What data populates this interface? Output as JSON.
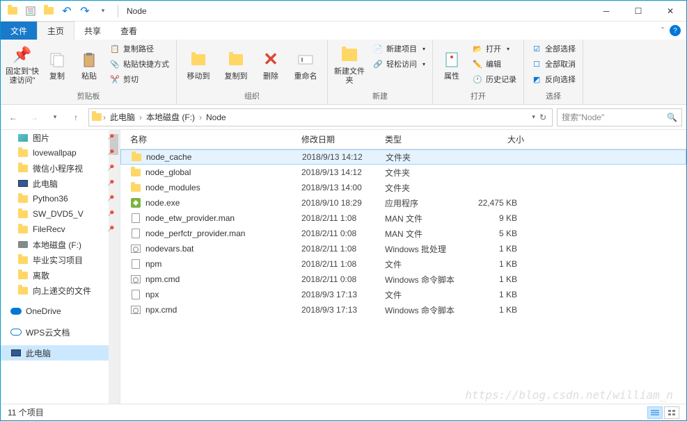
{
  "titlebar": {
    "title": "Node"
  },
  "tabs": {
    "file": "文件",
    "home": "主页",
    "share": "共享",
    "view": "查看"
  },
  "ribbon": {
    "pin": "固定到\"快速访问\"",
    "copy": "复制",
    "paste": "粘贴",
    "copypath": "复制路径",
    "pasteshortcut": "粘贴快捷方式",
    "cut": "剪切",
    "clipboard_group": "剪贴板",
    "moveto": "移动到",
    "copyto": "复制到",
    "delete": "删除",
    "rename": "重命名",
    "organize_group": "组织",
    "newfolder": "新建文件夹",
    "newitem": "新建项目",
    "easyaccess": "轻松访问",
    "new_group": "新建",
    "properties": "属性",
    "open": "打开",
    "edit": "编辑",
    "history": "历史记录",
    "open_group": "打开",
    "selectall": "全部选择",
    "selectnone": "全部取消",
    "invertsel": "反向选择",
    "select_group": "选择"
  },
  "breadcrumb": {
    "pc": "此电脑",
    "drive": "本地磁盘 (F:)",
    "folder": "Node"
  },
  "search": {
    "placeholder": "搜索\"Node\""
  },
  "columns": {
    "name": "名称",
    "date": "修改日期",
    "type": "类型",
    "size": "大小"
  },
  "sidebar": [
    {
      "label": "图片",
      "icon": "img",
      "pinned": true,
      "indent": 1
    },
    {
      "label": "lovewallpap",
      "icon": "folder",
      "pinned": true,
      "indent": 1
    },
    {
      "label": "微信小程序视",
      "icon": "folder",
      "pinned": true,
      "indent": 1
    },
    {
      "label": "此电脑",
      "icon": "pc",
      "pinned": true,
      "indent": 1
    },
    {
      "label": "Python36",
      "icon": "folder",
      "pinned": true,
      "indent": 1
    },
    {
      "label": "SW_DVD5_V",
      "icon": "folder",
      "pinned": true,
      "indent": 1
    },
    {
      "label": "FileRecv",
      "icon": "folder",
      "pinned": true,
      "indent": 1
    },
    {
      "label": "本地磁盘 (F:)",
      "icon": "disk",
      "pinned": false,
      "indent": 1
    },
    {
      "label": "毕业实习项目",
      "icon": "folder",
      "pinned": false,
      "indent": 1
    },
    {
      "label": "离散",
      "icon": "folder",
      "pinned": false,
      "indent": 1
    },
    {
      "label": "向上递交的文件",
      "icon": "folder",
      "pinned": false,
      "indent": 1
    },
    {
      "label": "",
      "icon": "",
      "spacer": true
    },
    {
      "label": "OneDrive",
      "icon": "cloud",
      "pinned": false,
      "indent": 0
    },
    {
      "label": "",
      "icon": "",
      "spacer": true
    },
    {
      "label": "WPS云文档",
      "icon": "cloud2",
      "pinned": false,
      "indent": 0
    },
    {
      "label": "",
      "icon": "",
      "spacer": true
    },
    {
      "label": "此电脑",
      "icon": "pc",
      "pinned": false,
      "indent": 0,
      "selected": true
    }
  ],
  "files": [
    {
      "name": "node_cache",
      "date": "2018/9/13 14:12",
      "type": "文件夹",
      "size": "",
      "icon": "folder",
      "selected": true
    },
    {
      "name": "node_global",
      "date": "2018/9/13 14:12",
      "type": "文件夹",
      "size": "",
      "icon": "folder"
    },
    {
      "name": "node_modules",
      "date": "2018/9/13 14:00",
      "type": "文件夹",
      "size": "",
      "icon": "folder"
    },
    {
      "name": "node.exe",
      "date": "2018/9/10 18:29",
      "type": "应用程序",
      "size": "22,475 KB",
      "icon": "exe"
    },
    {
      "name": "node_etw_provider.man",
      "date": "2018/2/11 1:08",
      "type": "MAN 文件",
      "size": "9 KB",
      "icon": "file"
    },
    {
      "name": "node_perfctr_provider.man",
      "date": "2018/2/11 0:08",
      "type": "MAN 文件",
      "size": "5 KB",
      "icon": "file"
    },
    {
      "name": "nodevars.bat",
      "date": "2018/2/11 1:08",
      "type": "Windows 批处理",
      "size": "1 KB",
      "icon": "bat"
    },
    {
      "name": "npm",
      "date": "2018/2/11 1:08",
      "type": "文件",
      "size": "1 KB",
      "icon": "file"
    },
    {
      "name": "npm.cmd",
      "date": "2018/2/11 0:08",
      "type": "Windows 命令脚本",
      "size": "1 KB",
      "icon": "bat"
    },
    {
      "name": "npx",
      "date": "2018/9/3 17:13",
      "type": "文件",
      "size": "1 KB",
      "icon": "file"
    },
    {
      "name": "npx.cmd",
      "date": "2018/9/3 17:13",
      "type": "Windows 命令脚本",
      "size": "1 KB",
      "icon": "bat"
    }
  ],
  "status": {
    "count": "11 个项目"
  },
  "watermark": "https://blog.csdn.net/william_n"
}
